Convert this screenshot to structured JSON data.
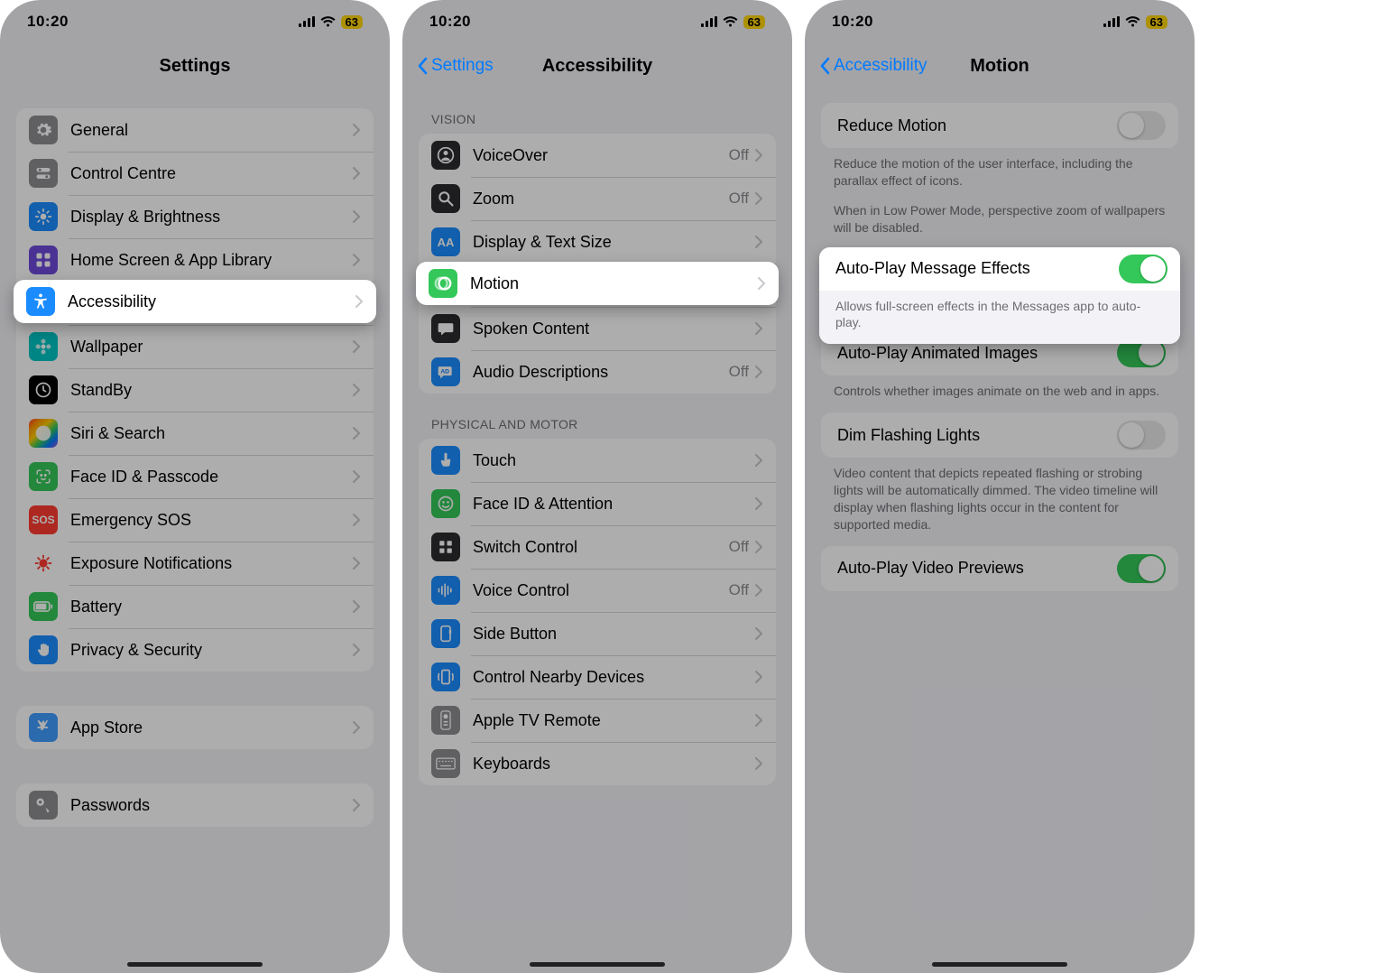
{
  "status": {
    "time": "10:20",
    "battery": "63"
  },
  "phone1": {
    "title": "Settings",
    "rows": [
      {
        "icon": "gear",
        "bg": "bg-gray",
        "label": "General"
      },
      {
        "icon": "toggles",
        "bg": "bg-gray",
        "label": "Control Centre"
      },
      {
        "icon": "sun",
        "bg": "bg-blue",
        "label": "Display & Brightness"
      },
      {
        "icon": "grid",
        "bg": "bg-purple",
        "label": "Home Screen & App Library"
      },
      {
        "icon": "accessibility",
        "bg": "bg-blue",
        "label": "Accessibility"
      },
      {
        "icon": "flower",
        "bg": "bg-teal",
        "label": "Wallpaper"
      },
      {
        "icon": "clock",
        "bg": "bg-black",
        "label": "StandBy"
      },
      {
        "icon": "siri",
        "bg": "bg-rainbow",
        "label": "Siri & Search"
      },
      {
        "icon": "faceid",
        "bg": "bg-green",
        "label": "Face ID & Passcode"
      },
      {
        "icon": "sos",
        "bg": "bg-red",
        "label": "Emergency SOS"
      },
      {
        "icon": "virus",
        "bg": "bg-redwhite",
        "label": "Exposure Notifications"
      },
      {
        "icon": "battery",
        "bg": "bg-green",
        "label": "Battery"
      },
      {
        "icon": "hand",
        "bg": "bg-blue",
        "label": "Privacy & Security"
      }
    ],
    "group2": [
      {
        "icon": "appstore",
        "bg": "bg-lblue",
        "label": "App Store"
      }
    ],
    "group3": [
      {
        "icon": "key",
        "bg": "bg-gray",
        "label": "Passwords"
      }
    ],
    "highlight_index": 4
  },
  "phone2": {
    "back": "Settings",
    "title": "Accessibility",
    "section_vision": "VISION",
    "vision_rows": [
      {
        "icon": "person-circle",
        "bg": "bg-dark",
        "label": "VoiceOver",
        "aux": "Off"
      },
      {
        "icon": "magnify",
        "bg": "bg-dark",
        "label": "Zoom",
        "aux": "Off"
      },
      {
        "icon": "textsize",
        "bg": "bg-blue",
        "label": "Display & Text Size",
        "aux": ""
      },
      {
        "icon": "motion",
        "bg": "bg-green",
        "label": "Motion",
        "aux": ""
      },
      {
        "icon": "speech",
        "bg": "bg-dark",
        "label": "Spoken Content",
        "aux": ""
      },
      {
        "icon": "ad",
        "bg": "bg-blue",
        "label": "Audio Descriptions",
        "aux": "Off"
      }
    ],
    "section_motor": "PHYSICAL AND MOTOR",
    "motor_rows": [
      {
        "icon": "touch",
        "bg": "bg-blue",
        "label": "Touch",
        "aux": ""
      },
      {
        "icon": "face",
        "bg": "bg-green",
        "label": "Face ID & Attention",
        "aux": ""
      },
      {
        "icon": "switch",
        "bg": "bg-dark",
        "label": "Switch Control",
        "aux": "Off"
      },
      {
        "icon": "voice",
        "bg": "bg-blue",
        "label": "Voice Control",
        "aux": "Off"
      },
      {
        "icon": "side",
        "bg": "bg-blue",
        "label": "Side Button",
        "aux": ""
      },
      {
        "icon": "nearby",
        "bg": "bg-blue",
        "label": "Control Nearby Devices",
        "aux": ""
      },
      {
        "icon": "tvremote",
        "bg": "bg-gray",
        "label": "Apple TV Remote",
        "aux": ""
      },
      {
        "icon": "keyboard",
        "bg": "bg-gray",
        "label": "Keyboards",
        "aux": ""
      }
    ],
    "highlight_index": 3
  },
  "phone3": {
    "back": "Accessibility",
    "title": "Motion",
    "blocks": [
      {
        "row_label": "Reduce Motion",
        "on": false,
        "footer": "Reduce the motion of the user interface, including the parallax effect of icons.",
        "footer2": "When in Low Power Mode, perspective zoom of wallpapers will be disabled."
      },
      {
        "row_label": "Auto-Play Message Effects",
        "on": true,
        "footer": "Allows full-screen effects in the Messages app to auto-play."
      },
      {
        "row_label": "Auto-Play Animated Images",
        "on": true,
        "footer": "Controls whether images animate on the web and in apps."
      },
      {
        "row_label": "Dim Flashing Lights",
        "on": false,
        "footer": "Video content that depicts repeated flashing or strobing lights will be automatically dimmed. The video timeline will display when flashing lights occur in the content for supported media."
      },
      {
        "row_label": "Auto-Play Video Previews",
        "on": true,
        "footer": ""
      }
    ],
    "highlight_index": 1
  }
}
